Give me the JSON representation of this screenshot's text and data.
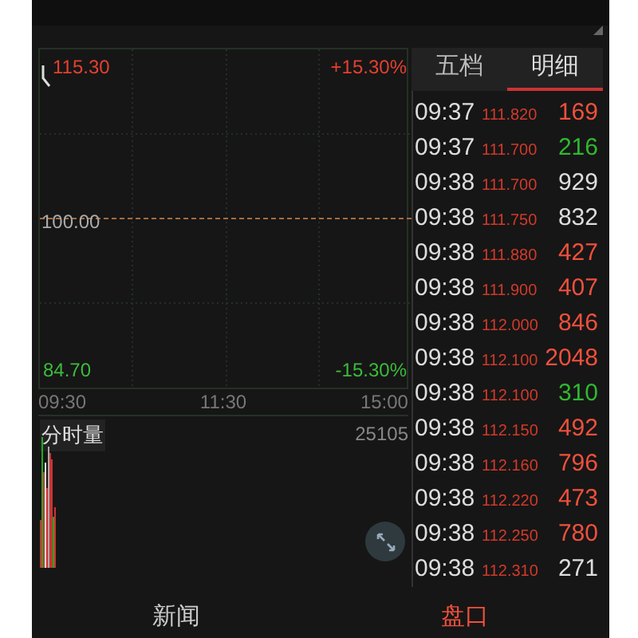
{
  "chart": {
    "price_high": "115.30",
    "pct_high": "+15.30%",
    "price_base": "100.00",
    "price_low": "84.70",
    "pct_low": "-15.30%",
    "times": [
      "09:30",
      "11:30",
      "15:00"
    ]
  },
  "volume": {
    "label": "分时量",
    "max": "25105"
  },
  "tabs": [
    {
      "label": "五档",
      "selected": false
    },
    {
      "label": "明细",
      "selected": true
    }
  ],
  "trades": [
    {
      "time": "09:37",
      "price": "111.820",
      "volume": "169",
      "color": "#f0503c"
    },
    {
      "time": "09:37",
      "price": "111.700",
      "volume": "216",
      "color": "#2fb82f"
    },
    {
      "time": "09:38",
      "price": "111.700",
      "volume": "929",
      "color": "#dddddd"
    },
    {
      "time": "09:38",
      "price": "111.750",
      "volume": "832",
      "color": "#dddddd"
    },
    {
      "time": "09:38",
      "price": "111.880",
      "volume": "427",
      "color": "#f0503c"
    },
    {
      "time": "09:38",
      "price": "111.900",
      "volume": "407",
      "color": "#f0503c"
    },
    {
      "time": "09:38",
      "price": "112.000",
      "volume": "846",
      "color": "#f0503c"
    },
    {
      "time": "09:38",
      "price": "112.100",
      "volume": "2048",
      "color": "#f0503c"
    },
    {
      "time": "09:38",
      "price": "112.100",
      "volume": "310",
      "color": "#2fb82f"
    },
    {
      "time": "09:38",
      "price": "112.150",
      "volume": "492",
      "color": "#f0503c"
    },
    {
      "time": "09:38",
      "price": "112.160",
      "volume": "796",
      "color": "#f0503c"
    },
    {
      "time": "09:38",
      "price": "112.220",
      "volume": "473",
      "color": "#f0503c"
    },
    {
      "time": "09:38",
      "price": "112.250",
      "volume": "780",
      "color": "#f0503c"
    },
    {
      "time": "09:38",
      "price": "112.310",
      "volume": "271",
      "color": "#dddddd"
    }
  ],
  "bottom_tabs": [
    {
      "label": "新闻",
      "selected": false
    },
    {
      "label": "盘口",
      "selected": true
    }
  ]
}
